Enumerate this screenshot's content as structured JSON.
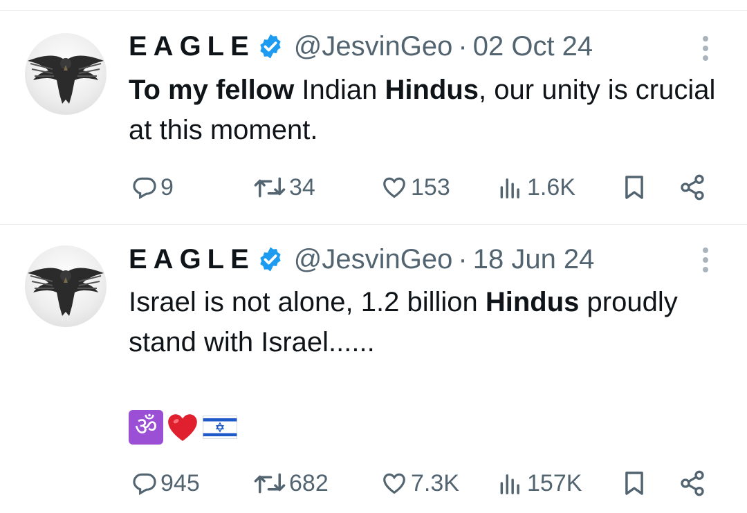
{
  "tweets": [
    {
      "display_name": "EAGLE",
      "handle": "@JesvinGeo",
      "separator": "·",
      "date": "02 Oct 24",
      "text_parts": [
        {
          "text": "To my fellow",
          "bold": true
        },
        {
          "text": " Indian ",
          "bold": false
        },
        {
          "text": "Hindus",
          "bold": true
        },
        {
          "text": ", our unity is crucial at this moment.",
          "bold": false
        }
      ],
      "emojis": [],
      "replies": "9",
      "reposts": "34",
      "likes": "153",
      "views": "1.6K"
    },
    {
      "display_name": "EAGLE",
      "handle": "@JesvinGeo",
      "separator": "·",
      "date": "18 Jun 24",
      "text_parts": [
        {
          "text": "Israel is not alone, 1.2 billion ",
          "bold": false
        },
        {
          "text": "Hindus",
          "bold": true
        },
        {
          "text": " proudly stand with Israel......",
          "bold": false
        }
      ],
      "emojis": [
        "om-symbol-emoji",
        "red-heart-emoji",
        "israel-flag-emoji"
      ],
      "om_glyph": "ॐ",
      "replies": "945",
      "reposts": "682",
      "likes": "7.3K",
      "views": "157K"
    }
  ],
  "colors": {
    "text": "#0f1419",
    "secondary": "#536471",
    "verified": "#1d9bf0",
    "divider": "#e6e9ec"
  },
  "icons": [
    "reply-icon",
    "repost-icon",
    "like-icon",
    "views-icon",
    "bookmark-icon",
    "share-icon",
    "more-icon",
    "verified-badge-icon"
  ]
}
